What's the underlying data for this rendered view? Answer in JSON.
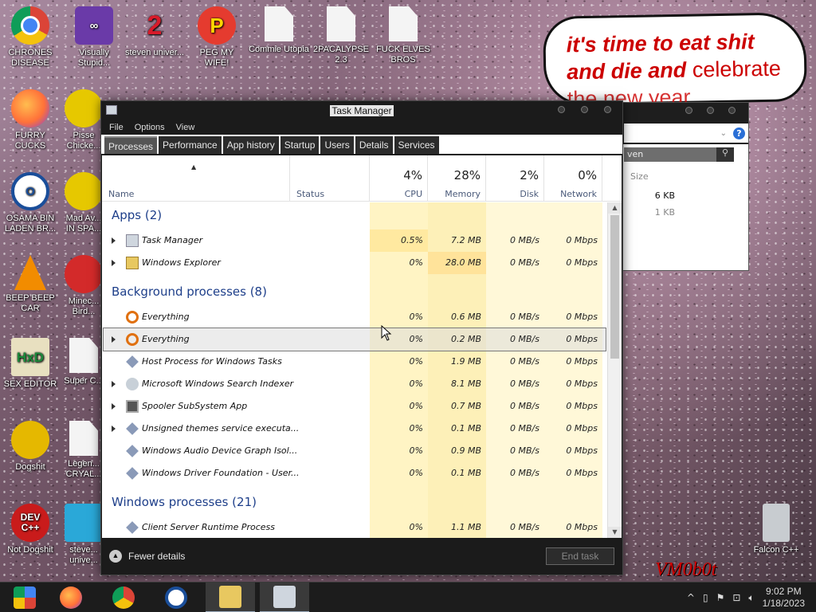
{
  "desktop": {
    "icons": [
      {
        "label": "CHRONES DISEASE"
      },
      {
        "label": "Visually Stupid..."
      },
      {
        "label": "steven univer..."
      },
      {
        "label": "PEG MY WIFE!"
      },
      {
        "label": "Commie Utopia"
      },
      {
        "label": "2PACALYPSE 2.3"
      },
      {
        "label": "FUCK ELVES BROS"
      },
      {
        "label": "FURRY CUCKS"
      },
      {
        "label": "Pisse Chicke..."
      },
      {
        "label": "OSAMA BIN LADEN BR..."
      },
      {
        "label": "Mad Av... IN SPA..."
      },
      {
        "label": "BEEP BEEP CAR"
      },
      {
        "label": "Minec... Bird..."
      },
      {
        "label": "SEX EDITOR"
      },
      {
        "label": "Super C..."
      },
      {
        "label": "Dogshit"
      },
      {
        "label": "Legen... CRYAL..."
      },
      {
        "label": "Not Dogshit"
      },
      {
        "label": "steve... unive..."
      },
      {
        "label": "Falcon C++"
      }
    ],
    "icon_glyphs": {
      "hxd": "HxD",
      "dev": "DEV C++",
      "poke": "P",
      "steven": "2"
    },
    "bubble": {
      "line1": "it's time to eat shit",
      "line2a": "and die and",
      "line2b": "celebrate",
      "line3": "the new year"
    },
    "watermark": "VM0b0t"
  },
  "explorer": {
    "search_text": "ven",
    "size_header": "Size",
    "sizes": [
      "6 KB",
      "1 KB"
    ]
  },
  "taskmanager": {
    "title": "Task Manager",
    "menu": [
      "File",
      "Options",
      "View"
    ],
    "tabs": [
      "Processes",
      "Performance",
      "App history",
      "Startup",
      "Users",
      "Details",
      "Services"
    ],
    "columns": {
      "name": "Name",
      "status": "Status",
      "cpu": {
        "pct": "4%",
        "label": "CPU"
      },
      "memory": {
        "pct": "28%",
        "label": "Memory"
      },
      "disk": {
        "pct": "2%",
        "label": "Disk"
      },
      "network": {
        "pct": "0%",
        "label": "Network"
      }
    },
    "groups": {
      "apps": "Apps (2)",
      "background": "Background processes (8)",
      "windows": "Windows processes (21)"
    },
    "rows": [
      {
        "name": "Task Manager",
        "cpu": "0.5%",
        "mem": "7.2 MB",
        "disk": "0 MB/s",
        "net": "0 Mbps"
      },
      {
        "name": "Windows Explorer",
        "cpu": "0%",
        "mem": "28.0 MB",
        "disk": "0 MB/s",
        "net": "0 Mbps"
      },
      {
        "name": "Everything",
        "cpu": "0%",
        "mem": "0.6 MB",
        "disk": "0 MB/s",
        "net": "0 Mbps"
      },
      {
        "name": "Everything",
        "cpu": "0%",
        "mem": "0.2 MB",
        "disk": "0 MB/s",
        "net": "0 Mbps"
      },
      {
        "name": "Host Process for Windows Tasks",
        "cpu": "0%",
        "mem": "1.9 MB",
        "disk": "0 MB/s",
        "net": "0 Mbps"
      },
      {
        "name": "Microsoft Windows Search Indexer",
        "cpu": "0%",
        "mem": "8.1 MB",
        "disk": "0 MB/s",
        "net": "0 Mbps"
      },
      {
        "name": "Spooler SubSystem App",
        "cpu": "0%",
        "mem": "0.7 MB",
        "disk": "0 MB/s",
        "net": "0 Mbps"
      },
      {
        "name": "Unsigned themes service executa...",
        "cpu": "0%",
        "mem": "0.1 MB",
        "disk": "0 MB/s",
        "net": "0 Mbps"
      },
      {
        "name": "Windows Audio Device Graph Isol...",
        "cpu": "0%",
        "mem": "0.9 MB",
        "disk": "0 MB/s",
        "net": "0 Mbps"
      },
      {
        "name": "Windows Driver Foundation - User...",
        "cpu": "0%",
        "mem": "0.1 MB",
        "disk": "0 MB/s",
        "net": "0 Mbps"
      },
      {
        "name": "Client Server Runtime Process",
        "cpu": "0%",
        "mem": "1.1 MB",
        "disk": "0 MB/s",
        "net": "0 Mbps"
      }
    ],
    "fewer_details": "Fewer details",
    "end_task": "End task"
  },
  "taskbar": {
    "time": "9:02 PM",
    "date": "1/18/2023"
  },
  "colors": {
    "cpu_col": "#fff4c4",
    "mem_col": "#fdf0b8",
    "other_col": "#fff8d8",
    "group_text": "#1e3f8a"
  }
}
